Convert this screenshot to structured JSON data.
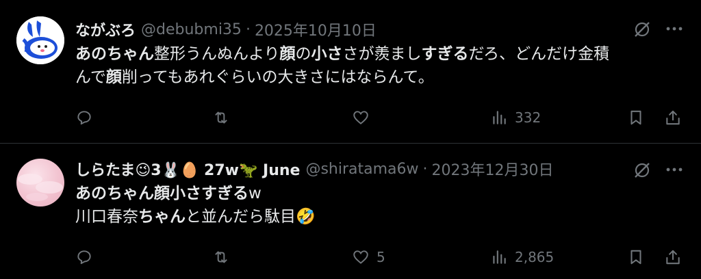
{
  "tweets": [
    {
      "name": "ながぶろ",
      "handle": "@debubmi35",
      "separator": "·",
      "date": "2025年10月10日",
      "line1": [
        {
          "t": "あのちゃん",
          "b": true
        },
        {
          "t": "整形うんぬんより",
          "b": false
        },
        {
          "t": "顔",
          "b": true
        },
        {
          "t": "の",
          "b": false
        },
        {
          "t": "小さ",
          "b": true
        },
        {
          "t": "さが羨まし",
          "b": false
        },
        {
          "t": "すぎる",
          "b": true
        },
        {
          "t": "だろ、どんだけ金積",
          "b": false
        }
      ],
      "line2": [
        {
          "t": "んで",
          "b": false
        },
        {
          "t": "顔",
          "b": true
        },
        {
          "t": "削ってもあれぐらいの大きさにはならんて。",
          "b": false
        }
      ],
      "actions": {
        "replies": "",
        "retweets": "",
        "likes": "",
        "views": "332"
      },
      "avatar_icon": "rabbit-avatar-icon"
    },
    {
      "name": "しらたま😉3🐰🥚 27w🦖 June",
      "handle": "@shiratama6w",
      "separator": "·",
      "date": "2023年12月30日",
      "line1": [
        {
          "t": "あのちゃん顔小さすぎる",
          "b": true
        },
        {
          "t": "w",
          "b": false
        }
      ],
      "line2": [
        {
          "t": "川口春奈",
          "b": false
        },
        {
          "t": "ちゃん",
          "b": true
        },
        {
          "t": "と並んだら駄目🤣",
          "b": false
        }
      ],
      "actions": {
        "replies": "",
        "retweets": "",
        "likes": "5",
        "views": "2,865"
      },
      "avatar_icon": "pink-cloud-avatar"
    }
  ],
  "icons": {
    "reply": "reply-icon",
    "retweet": "retweet-icon",
    "like": "like-icon",
    "views": "views-icon",
    "bookmark": "bookmark-icon",
    "share": "share-icon",
    "grok": "grok-icon",
    "more": "more-icon"
  },
  "colors": {
    "background": "#000000",
    "text": "#e7e9ea",
    "muted": "#71767b",
    "divider": "#2f3336"
  }
}
